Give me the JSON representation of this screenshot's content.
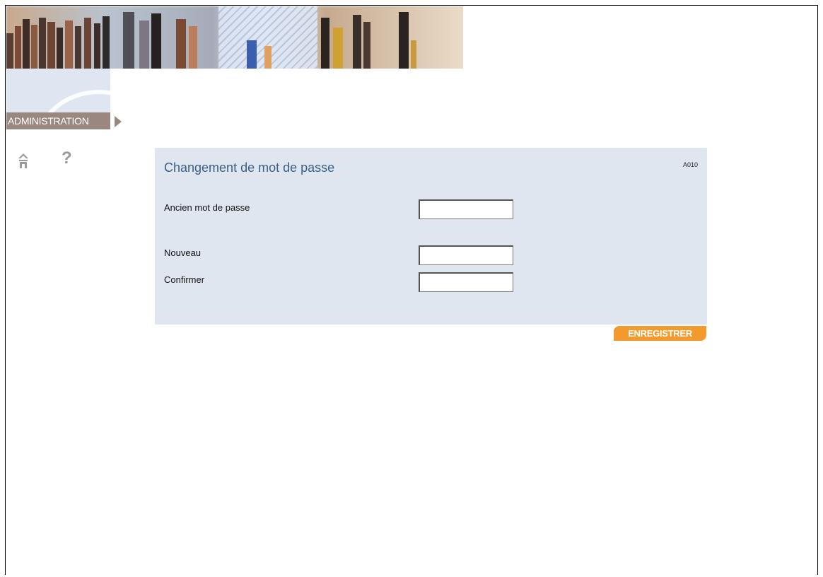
{
  "section": {
    "label": "ADMINISTRATION"
  },
  "tools": {
    "help_glyph": "?"
  },
  "form": {
    "title": "Changement de mot de passe",
    "code": "A010",
    "fields": [
      {
        "label": "Ancien mot de passe",
        "value": ""
      },
      {
        "label": "Nouveau",
        "value": ""
      },
      {
        "label": "Confirmer",
        "value": ""
      }
    ],
    "save_label": "ENREGISTRER"
  },
  "colors": {
    "accent": "#f29a2e",
    "panel_bg": "#dfe6f0",
    "title": "#3c5f85",
    "admin_tab": "#9a8880"
  },
  "icons": [
    "home-icon",
    "help-icon",
    "arrow-right-icon"
  ]
}
